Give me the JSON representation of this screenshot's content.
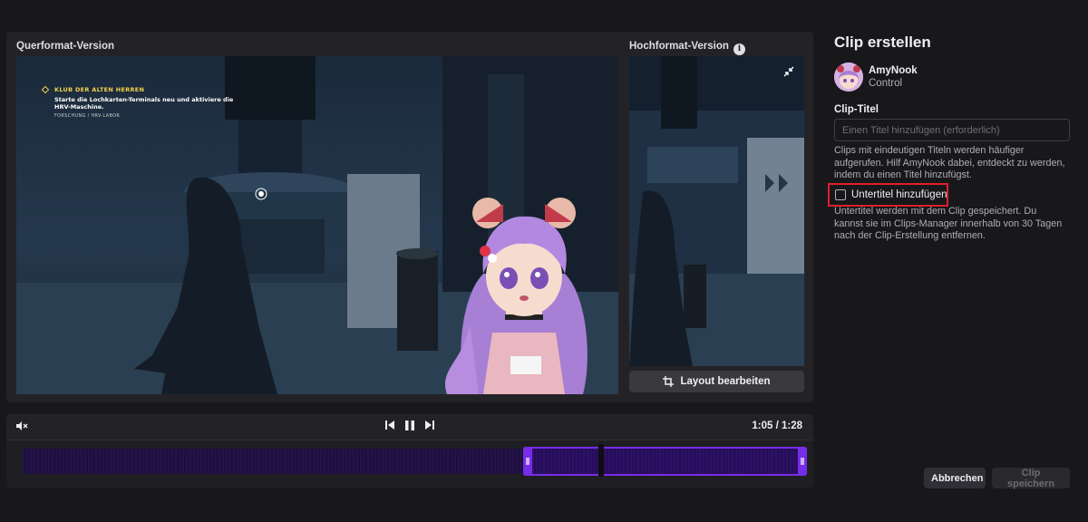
{
  "preview": {
    "landscape_label": "Querformat-Version",
    "portrait_label": "Hochformat-Version",
    "info_icon": "info-icon",
    "hud": {
      "title": "KLUB DER ALTEN HERREN",
      "line1": "Starte die Lochkarten-Terminals neu und aktiviere die",
      "line2": "HRV-Maschine.",
      "location": "FORSCHUNG / HRV-LABOR"
    },
    "layout_button": "Layout bearbeiten"
  },
  "player": {
    "time": "1:05 / 1:28",
    "muted": true,
    "icons": [
      "mute-icon",
      "skip-back-icon",
      "pause-icon",
      "skip-forward-icon"
    ],
    "playhead_fraction": 0.738,
    "selection_start_fraction": 0.638,
    "selection_end_fraction": 1.0
  },
  "clip_panel": {
    "title": "Clip erstellen",
    "channel": "AmyNook",
    "game": "Control",
    "title_field_label": "Clip-Titel",
    "title_placeholder": "Einen Titel hinzufügen (erforderlich)",
    "title_value": "",
    "help_text": "Clips mit eindeutigen Titeln werden häufiger aufgerufen. Hilf AmyNook dabei, entdeckt zu werden, indem du einen Titel hinzufügst.",
    "subtitle_checkbox_label": "Untertitel hinzufügen",
    "subtitle_checked": false,
    "subtitle_help": "Untertitel werden mit dem Clip gespeichert. Du kannst sie im Clips-Manager innerhalb von 30 Tagen nach der Clip-Erstellung entfernen.",
    "cancel_label": "Abbrechen",
    "save_label": "Clip speichern"
  },
  "colors": {
    "background": "#18181b",
    "panel": "#232327",
    "accent_purple": "#772ce8",
    "highlight_red": "#e01e2b",
    "hud_yellow": "#f1d34a"
  }
}
